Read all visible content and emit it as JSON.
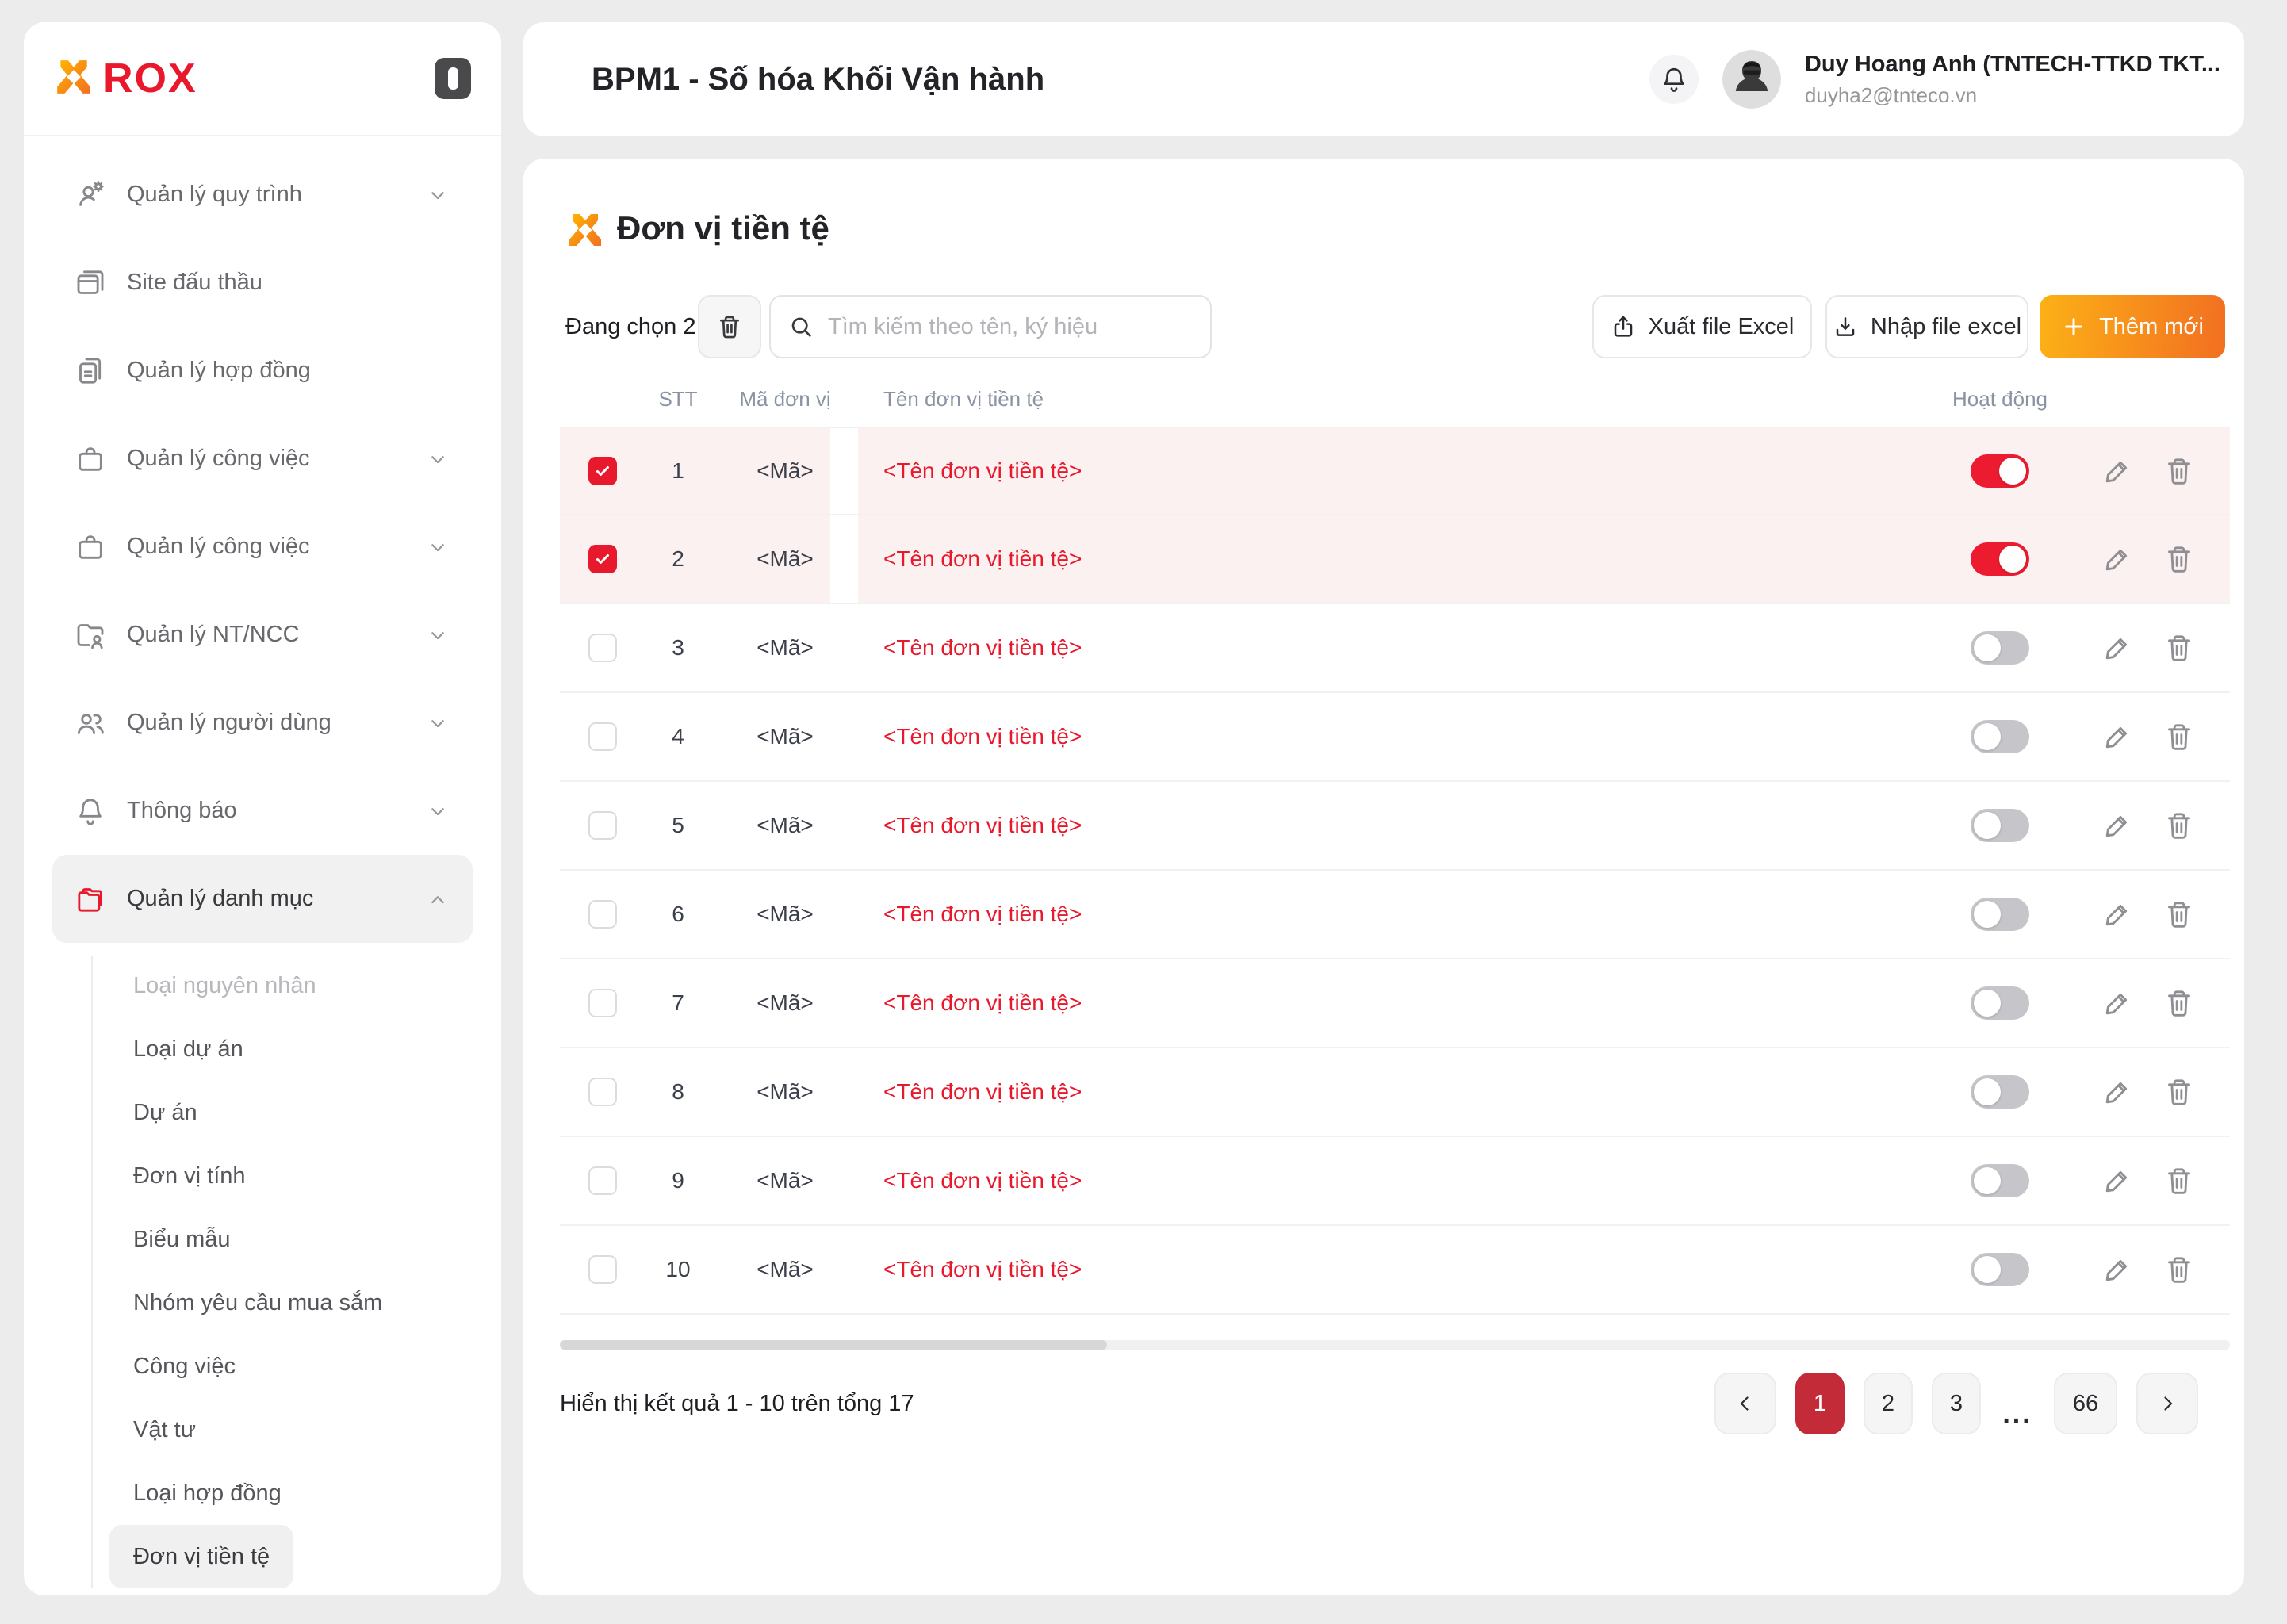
{
  "brand": {
    "logo_text": "ROX"
  },
  "colors": {
    "accent_red": "#E8192C",
    "toggle_on": "#ED1B2F",
    "row_selected_bg": "#FBF1F1",
    "pagination_active": "#C32B39",
    "add_button_gradient_start": "#FCB116",
    "add_button_gradient_end": "#F26F21"
  },
  "topbar": {
    "title": "BPM1 - Số hóa Khối Vận hành",
    "user": {
      "name": "Duy Hoang Anh (TNTECH-TTKD TKT...",
      "email": "duyha2@tnteco.vn"
    }
  },
  "sidebar": {
    "items": [
      {
        "label": "Quản lý quy trình",
        "icon": "user-gear",
        "chevron": "down",
        "active": false
      },
      {
        "label": "Site đấu thầu",
        "icon": "window",
        "chevron": "",
        "active": false
      },
      {
        "label": "Quản lý hợp đồng",
        "icon": "file-copy",
        "chevron": "",
        "active": false
      },
      {
        "label": "Quản lý công việc",
        "icon": "bag",
        "chevron": "down",
        "active": false
      },
      {
        "label": "Quản lý công việc",
        "icon": "bag",
        "chevron": "down",
        "active": false
      },
      {
        "label": "Quản lý NT/NCC",
        "icon": "folder-user",
        "chevron": "down",
        "active": false
      },
      {
        "label": "Quản lý người dùng",
        "icon": "users",
        "chevron": "down",
        "active": false
      },
      {
        "label": "Thông báo",
        "icon": "bell",
        "chevron": "down",
        "active": false
      },
      {
        "label": "Quản lý danh mục",
        "icon": "folder",
        "chevron": "up",
        "active": true
      }
    ],
    "submenu": [
      {
        "label": "Loại nguyên nhân",
        "muted": true,
        "active": false
      },
      {
        "label": "Loại dự án",
        "muted": false,
        "active": false
      },
      {
        "label": "Dự án",
        "muted": false,
        "active": false
      },
      {
        "label": "Đơn vị tính",
        "muted": false,
        "active": false
      },
      {
        "label": "Biểu mẫu",
        "muted": false,
        "active": false
      },
      {
        "label": "Nhóm yêu cầu mua sắm",
        "muted": false,
        "active": false
      },
      {
        "label": "Công việc",
        "muted": false,
        "active": false
      },
      {
        "label": "Vật tư",
        "muted": false,
        "active": false
      },
      {
        "label": "Loại hợp đồng",
        "muted": false,
        "active": false
      },
      {
        "label": "Đơn vị tiền tệ",
        "muted": false,
        "active": true
      }
    ]
  },
  "page": {
    "title": "Đơn vị tiền tệ",
    "selection_label": "Đang chọn 2",
    "search_placeholder": "Tìm kiếm theo tên, ký hiệu",
    "export_label": "Xuất file Excel",
    "import_label": "Nhập file excel",
    "add_label": "Thêm mới"
  },
  "table": {
    "columns": [
      "STT",
      "Mã đơn vị",
      "Tên đơn vị tiền tệ",
      "Hoạt động"
    ],
    "rows": [
      {
        "stt": "1",
        "code": "<Mã>",
        "name": "<Tên đơn vị tiền tệ>",
        "selected": true,
        "active": true
      },
      {
        "stt": "2",
        "code": "<Mã>",
        "name": "<Tên đơn vị tiền tệ>",
        "selected": true,
        "active": true
      },
      {
        "stt": "3",
        "code": "<Mã>",
        "name": "<Tên đơn vị tiền tệ>",
        "selected": false,
        "active": false
      },
      {
        "stt": "4",
        "code": "<Mã>",
        "name": "<Tên đơn vị tiền tệ>",
        "selected": false,
        "active": false
      },
      {
        "stt": "5",
        "code": "<Mã>",
        "name": "<Tên đơn vị tiền tệ>",
        "selected": false,
        "active": false
      },
      {
        "stt": "6",
        "code": "<Mã>",
        "name": "<Tên đơn vị tiền tệ>",
        "selected": false,
        "active": false
      },
      {
        "stt": "7",
        "code": "<Mã>",
        "name": "<Tên đơn vị tiền tệ>",
        "selected": false,
        "active": false
      },
      {
        "stt": "8",
        "code": "<Mã>",
        "name": "<Tên đơn vị tiền tệ>",
        "selected": false,
        "active": false
      },
      {
        "stt": "9",
        "code": "<Mã>",
        "name": "<Tên đơn vị tiền tệ>",
        "selected": false,
        "active": false
      },
      {
        "stt": "10",
        "code": "<Mã>",
        "name": "<Tên đơn vị tiền tệ>",
        "selected": false,
        "active": false
      }
    ]
  },
  "footer": {
    "summary": "Hiển thị kết quả 1 - 10 trên tổng 17",
    "pages": [
      {
        "label": "1",
        "active": true,
        "dots": false,
        "wide": false
      },
      {
        "label": "2",
        "active": false,
        "dots": false,
        "wide": false
      },
      {
        "label": "3",
        "active": false,
        "dots": false,
        "wide": false
      },
      {
        "label": "...",
        "active": false,
        "dots": true,
        "wide": false
      },
      {
        "label": "66",
        "active": false,
        "dots": false,
        "wide": true
      }
    ]
  }
}
